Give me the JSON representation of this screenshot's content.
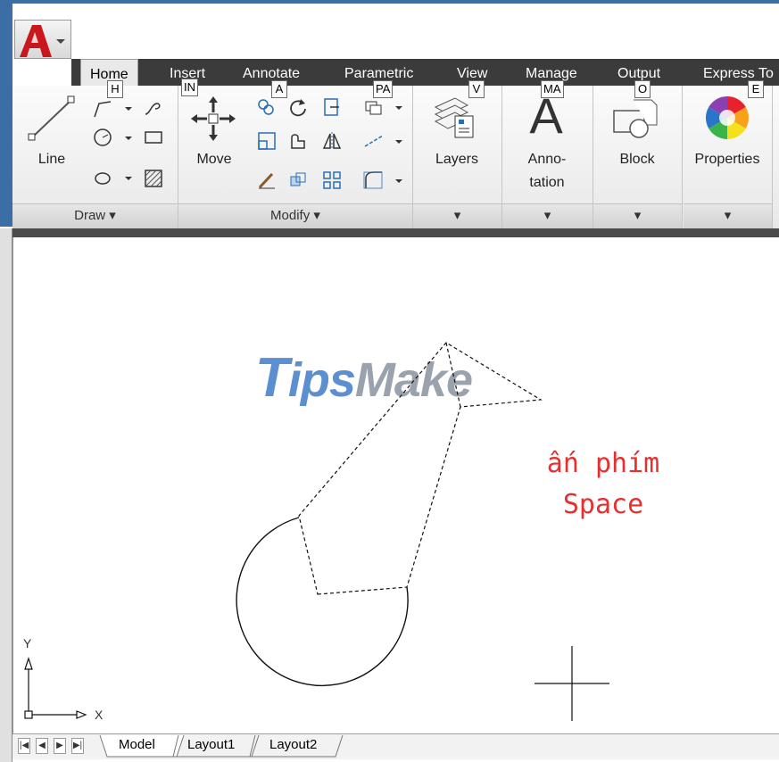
{
  "ribbon_tabs": [
    "Home",
    "Insert",
    "Annotate",
    "Parametric",
    "View",
    "Manage",
    "Output",
    "Express To"
  ],
  "keytips": {
    "home": "H",
    "insert": "IN",
    "annotate": "A",
    "parametric": "PA",
    "view": "V",
    "manage": "MA",
    "output": "O",
    "express": "E"
  },
  "draw_panel": {
    "line_label": "Line",
    "footer": "Draw ▾"
  },
  "modify_panel": {
    "move_label": "Move",
    "footer": "Modify ▾"
  },
  "layers_label": "Layers",
  "annotation_label_line1": "Anno-",
  "annotation_label_line2": "tation",
  "annotation_letter": "A",
  "block_label": "Block",
  "properties_label": "Properties",
  "panel_expand": "▾",
  "canvas": {
    "watermark_part1": "T",
    "watermark_part2": "ips",
    "watermark_part3": "Make",
    "annotation_line1": "ấn phím",
    "annotation_line2": "Space",
    "ucs_x": "X",
    "ucs_y": "Y"
  },
  "layout_tabs": [
    "Model",
    "Layout1",
    "Layout2"
  ],
  "nav_buttons": [
    "|◀",
    "◀",
    "▶",
    "▶|"
  ],
  "colors": {
    "accent_blue": "#3a6ea5",
    "annotation_red": "#e53030",
    "watermark_blue": "#5b8fd0",
    "watermark_grey": "#9aa3ad"
  }
}
